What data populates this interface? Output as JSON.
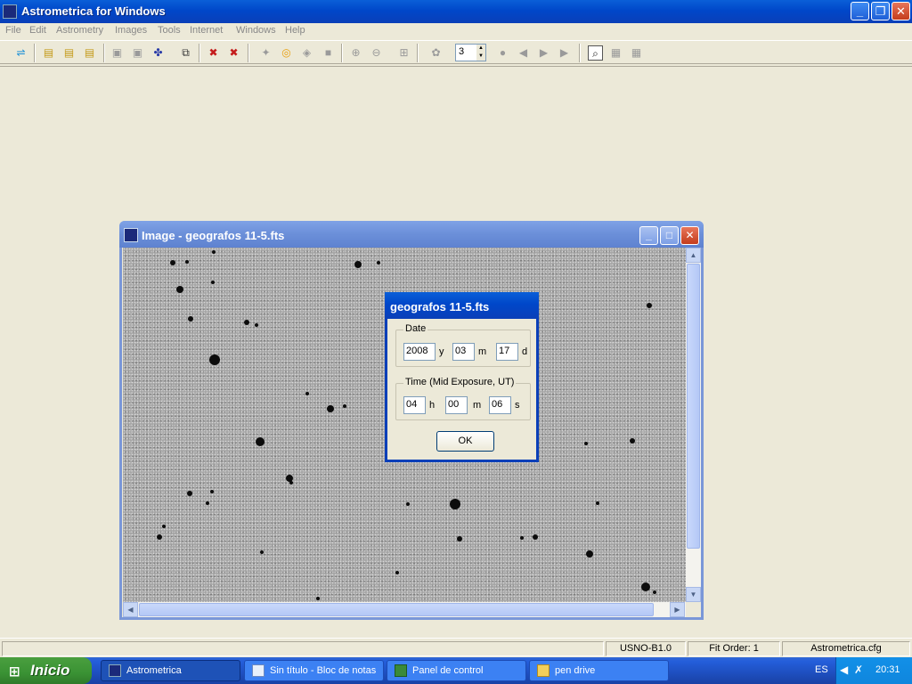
{
  "app": {
    "title": "Astrometrica for Windows"
  },
  "menu": [
    "File",
    "Edit",
    "Astrometry",
    "Images",
    "Tools",
    "Internet",
    "Windows",
    "Help"
  ],
  "toolbar": {
    "spinner_value": "3"
  },
  "image_window": {
    "title": "Image - geografos 11-5.fts"
  },
  "dialog": {
    "title": "geografos 11-5.fts",
    "date_group": "Date",
    "year": "2008",
    "year_unit": "y",
    "month": "03",
    "month_unit": "m",
    "day": "17",
    "day_unit": "d",
    "time_group": "Time (Mid Exposure, UT)",
    "hour": "04",
    "hour_unit": "h",
    "minute": "00",
    "minute_unit": "m",
    "second": "06",
    "second_unit": "s",
    "ok_label": "OK"
  },
  "status": {
    "catalog": "USNO-B1.0",
    "fit_order": "Fit Order: 1",
    "config": "Astrometrica.cfg"
  },
  "taskbar": {
    "start_label": "Inicio",
    "tasks": [
      "Astrometrica",
      "Sin título - Bloc de notas",
      "Panel de control",
      "pen drive"
    ],
    "language": "ES",
    "clock": "20:31"
  },
  "colors": {
    "title_blue": "#0a3fb8",
    "start_green": "#3a9234",
    "face": "#ece9d8"
  }
}
